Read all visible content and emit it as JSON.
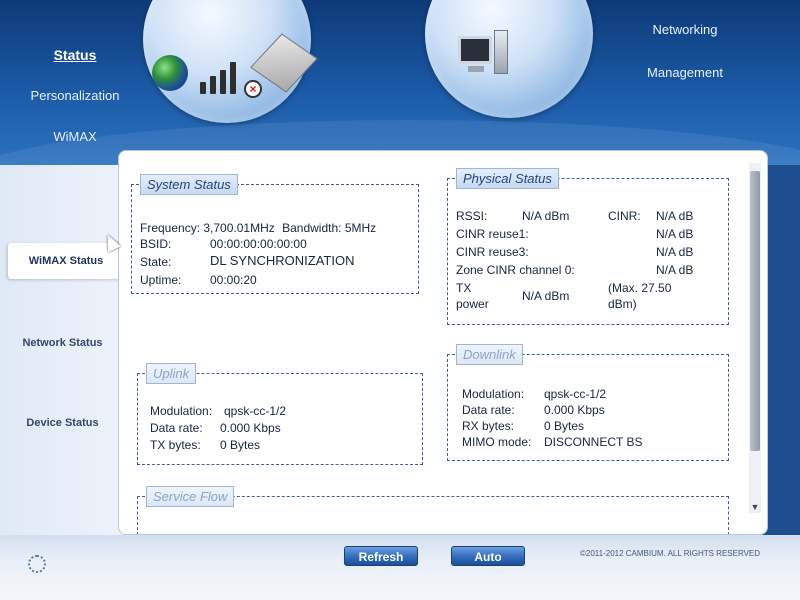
{
  "nav_left": [
    "Status",
    "Personalization",
    "WiMAX"
  ],
  "nav_right": [
    "Networking",
    "Management"
  ],
  "icons": {
    "status_bubble": [
      "globe-icon",
      "signal-bars-icon",
      "disconnect-x-icon",
      "device-icon"
    ],
    "network_bubble": "computer-icon"
  },
  "side_nav": [
    "WiMAX Status",
    "Network Status",
    "Device Status"
  ],
  "system_status": {
    "title": "System Status",
    "frequency_label": "Frequency:",
    "frequency_value": "3,700.01MHz",
    "bandwidth_label": "Bandwidth:",
    "bandwidth_value": "5MHz",
    "bsid_label": "BSID:",
    "bsid_value": "00:00:00:00:00:00",
    "state_label": "State:",
    "state_value": "DL SYNCHRONIZATION",
    "uptime_label": "Uptime:",
    "uptime_value": "00:00:20"
  },
  "physical_status": {
    "title": "Physical Status",
    "rssi_label": "RSSI:",
    "rssi_value": "N/A dBm",
    "cinr_label": "CINR:",
    "cinr_value": "N/A dB",
    "cinr_reuse1_label": "CINR reuse1:",
    "cinr_reuse1_value": "N/A dB",
    "cinr_reuse3_label": "CINR reuse3:",
    "cinr_reuse3_value": "N/A dB",
    "zone_cinr_label": "Zone CINR channel 0:",
    "zone_cinr_value": "N/A dB",
    "tx_label_1": "TX",
    "tx_label_2": "power",
    "tx_value": "N/A dBm",
    "tx_max_1": "(Max. 27.50",
    "tx_max_2": "dBm)"
  },
  "uplink": {
    "title": "Uplink",
    "modulation_label": "Modulation:",
    "modulation_value": "qpsk-cc-1/2",
    "data_rate_label": "Data rate:",
    "data_rate_value": "0.000 Kbps",
    "tx_bytes_label": "TX bytes:",
    "tx_bytes_value": "0 Bytes"
  },
  "downlink": {
    "title": "Downlink",
    "modulation_label": "Modulation:",
    "modulation_value": "qpsk-cc-1/2",
    "data_rate_label": "Data rate:",
    "data_rate_value": "0.000 Kbps",
    "rx_bytes_label": "RX bytes:",
    "rx_bytes_value": "0 Bytes",
    "mimo_label": "MIMO mode:",
    "mimo_value": "DISCONNECT BS"
  },
  "service_flow": {
    "title": "Service Flow"
  },
  "footer": {
    "refresh_label": "Refresh",
    "auto_label": "Auto",
    "copyright": "©2011-2012 CAMBIUM. ALL RIGHTS RESERVED"
  },
  "colors": {
    "header_blue": "#1b5aa6",
    "panel_border": "#3f5f94",
    "button_blue": "#2f68b8"
  }
}
